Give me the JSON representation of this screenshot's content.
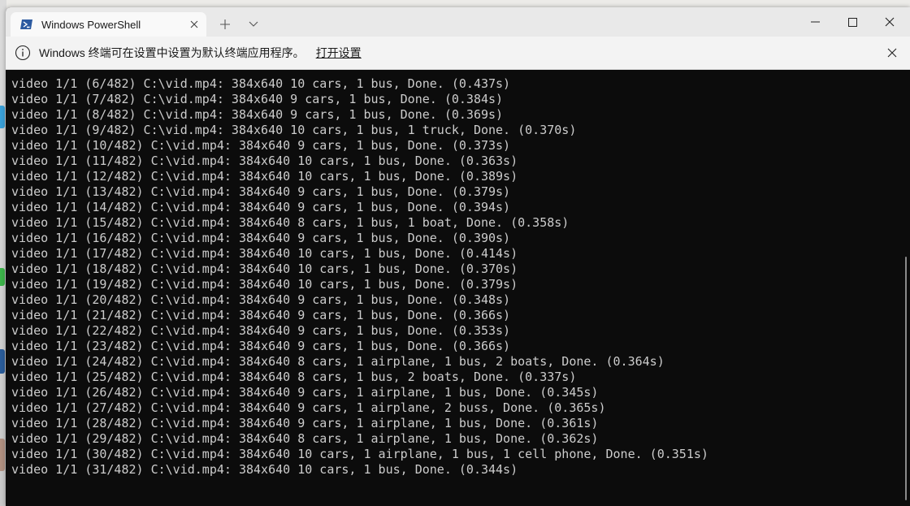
{
  "window": {
    "tab_title": "Windows PowerShell",
    "tab_icon": "powershell-icon",
    "controls": [
      "minimize-icon",
      "maximize-icon",
      "close-icon"
    ]
  },
  "infobar": {
    "message": "Windows 终端可在设置中设置为默认终端应用程序。",
    "link": "打开设置"
  },
  "terminal": {
    "lines": [
      "video 1/1 (6/482) C:\\vid.mp4: 384x640 10 cars, 1 bus, Done. (0.437s)",
      "video 1/1 (7/482) C:\\vid.mp4: 384x640 9 cars, 1 bus, Done. (0.384s)",
      "video 1/1 (8/482) C:\\vid.mp4: 384x640 9 cars, 1 bus, Done. (0.369s)",
      "video 1/1 (9/482) C:\\vid.mp4: 384x640 10 cars, 1 bus, 1 truck, Done. (0.370s)",
      "video 1/1 (10/482) C:\\vid.mp4: 384x640 9 cars, 1 bus, Done. (0.373s)",
      "video 1/1 (11/482) C:\\vid.mp4: 384x640 10 cars, 1 bus, Done. (0.363s)",
      "video 1/1 (12/482) C:\\vid.mp4: 384x640 10 cars, 1 bus, Done. (0.389s)",
      "video 1/1 (13/482) C:\\vid.mp4: 384x640 9 cars, 1 bus, Done. (0.379s)",
      "video 1/1 (14/482) C:\\vid.mp4: 384x640 9 cars, 1 bus, Done. (0.394s)",
      "video 1/1 (15/482) C:\\vid.mp4: 384x640 8 cars, 1 bus, 1 boat, Done. (0.358s)",
      "video 1/1 (16/482) C:\\vid.mp4: 384x640 9 cars, 1 bus, Done. (0.390s)",
      "video 1/1 (17/482) C:\\vid.mp4: 384x640 10 cars, 1 bus, Done. (0.414s)",
      "video 1/1 (18/482) C:\\vid.mp4: 384x640 10 cars, 1 bus, Done. (0.370s)",
      "video 1/1 (19/482) C:\\vid.mp4: 384x640 10 cars, 1 bus, Done. (0.379s)",
      "video 1/1 (20/482) C:\\vid.mp4: 384x640 9 cars, 1 bus, Done. (0.348s)",
      "video 1/1 (21/482) C:\\vid.mp4: 384x640 9 cars, 1 bus, Done. (0.366s)",
      "video 1/1 (22/482) C:\\vid.mp4: 384x640 9 cars, 1 bus, Done. (0.353s)",
      "video 1/1 (23/482) C:\\vid.mp4: 384x640 9 cars, 1 bus, Done. (0.366s)",
      "video 1/1 (24/482) C:\\vid.mp4: 384x640 8 cars, 1 airplane, 1 bus, 2 boats, Done. (0.364s)",
      "video 1/1 (25/482) C:\\vid.mp4: 384x640 8 cars, 1 bus, 2 boats, Done. (0.337s)",
      "video 1/1 (26/482) C:\\vid.mp4: 384x640 9 cars, 1 airplane, 1 bus, Done. (0.345s)",
      "video 1/1 (27/482) C:\\vid.mp4: 384x640 9 cars, 1 airplane, 2 buss, Done. (0.365s)",
      "video 1/1 (28/482) C:\\vid.mp4: 384x640 9 cars, 1 airplane, 1 bus, Done. (0.361s)",
      "video 1/1 (29/482) C:\\vid.mp4: 384x640 8 cars, 1 airplane, 1 bus, Done. (0.362s)",
      "video 1/1 (30/482) C:\\vid.mp4: 384x640 10 cars, 1 airplane, 1 bus, 1 cell phone, Done. (0.351s)",
      "video 1/1 (31/482) C:\\vid.mp4: 384x640 10 cars, 1 bus, Done. (0.344s)"
    ]
  },
  "colors": {
    "terminal_bg": "#0c0c0c",
    "terminal_fg": "#cccccc",
    "titlebar_bg": "#e9e9e9",
    "infobar_bg": "#f3f3f3"
  }
}
